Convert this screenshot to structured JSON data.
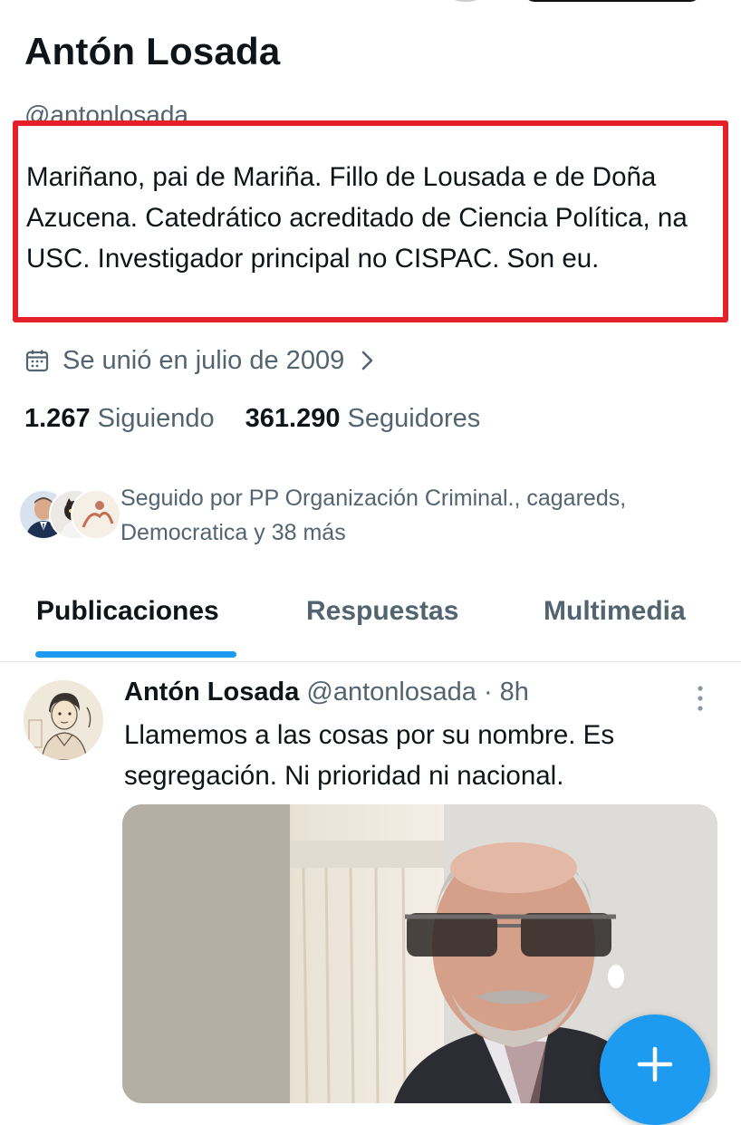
{
  "profile": {
    "name": "Antón Losada",
    "handle": "@antonlosada",
    "bio": "Mariñano, pai de Mariña. Fillo de Lousada e de Doña Azucena. Catedrático acreditado de Ciencia Política, na USC. Investigador principal no CISPAC. Son eu.",
    "joined": "Se unió en julio de 2009",
    "following_count": "1.267",
    "following_label": "Siguiendo",
    "followers_count": "361.290",
    "followers_label": "Seguidores",
    "followed_by": "Seguido por PP Organización Criminal., cagareds, Democratica y 38 más"
  },
  "tabs": [
    {
      "label": "Publicaciones",
      "active": true
    },
    {
      "label": "Respuestas",
      "active": false
    },
    {
      "label": "Multimedia",
      "active": false
    }
  ],
  "post": {
    "author_name": "Antón Losada",
    "author_handle": "@antonlosada",
    "separator": "·",
    "time": "8h",
    "text": "Llamemos a las cosas por su nombre. Es segregación. Ni prioridad ni nacional."
  },
  "icons": {
    "calendar": "calendar-icon",
    "chevron": "chevron-right-icon",
    "more": "more-vertical-icon",
    "compose": "plus-icon"
  },
  "colors": {
    "accent": "#1d9bf0",
    "highlight_box": "#e5202a",
    "secondary_text": "#536471"
  }
}
